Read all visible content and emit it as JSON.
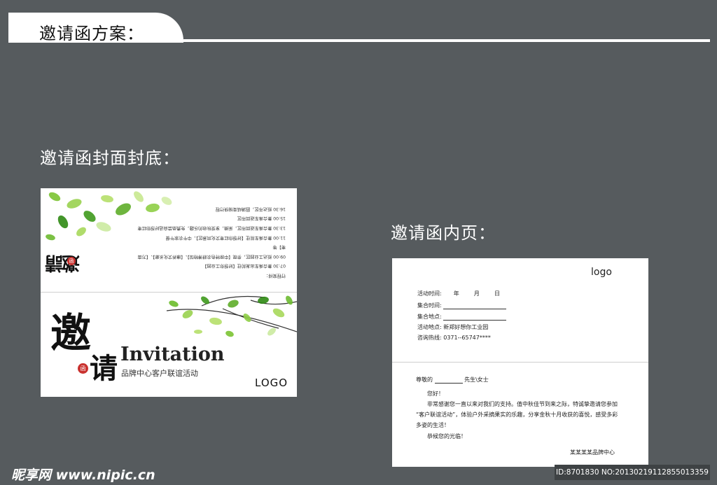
{
  "header": {
    "title": "邀请函方案："
  },
  "sections": {
    "cover_label": "邀请函封面封底：",
    "inner_label": "邀请函内页："
  },
  "cover": {
    "back_schedule": [
      "行程安排：",
      "07:30 集合乘车出发前往【好想你工业园】",
      "09:00 抵达工业园区，参观【中原特色农耕博物馆】、【康养文化长廊】、【万亩",
      "枣】等",
      "11:00 集合乘车前往【好想你红枣文化风景区】，中午农家午餐",
      "13:30 集合乘车返回市区，采摘，享受秋收的乐趣，免费品尝自选好想你红枣",
      "15:00 集合乘车返回市区",
      "16:30 抵达市区，圆满结束愉快行程"
    ],
    "back_mark": "邀請",
    "back_seal": "函",
    "title_char1": "邀",
    "title_char2": "请",
    "seal": "函",
    "title_en": "Invitation",
    "subtitle": "品牌中心客户联谊活动",
    "logo": "LOGO"
  },
  "inner": {
    "logo": "logo",
    "fields": {
      "time_label": "活动时间:",
      "year": "年",
      "month": "月",
      "day": "日",
      "gather_time_label": "集合时间:",
      "gather_place_label": "集合地点:",
      "place_label": "活动地点:",
      "place_value": "新郑好想你工业园",
      "hotline_label": "咨询热线:",
      "hotline_value": "0371--65747****"
    },
    "letter": {
      "salutation": "尊敬的",
      "honorific": "先生\\女士",
      "greeting": "您好！",
      "line1": "非常感谢您一直以来对我们的支持。值中秋佳节到来之际，特诚挚邀请您参加",
      "line2": "“客户联谊活动”，体验户外采摘果实的乐趣，分享金秋十月收获的喜悦，感受多彩",
      "line3": "多姿的生活！",
      "closing": "恭候您的光临！",
      "signature": "某某某某品牌中心"
    }
  },
  "footer": {
    "site": "昵享网 www.nipic.cn",
    "id": "ID:8701830 NO:20130219112855013359"
  }
}
